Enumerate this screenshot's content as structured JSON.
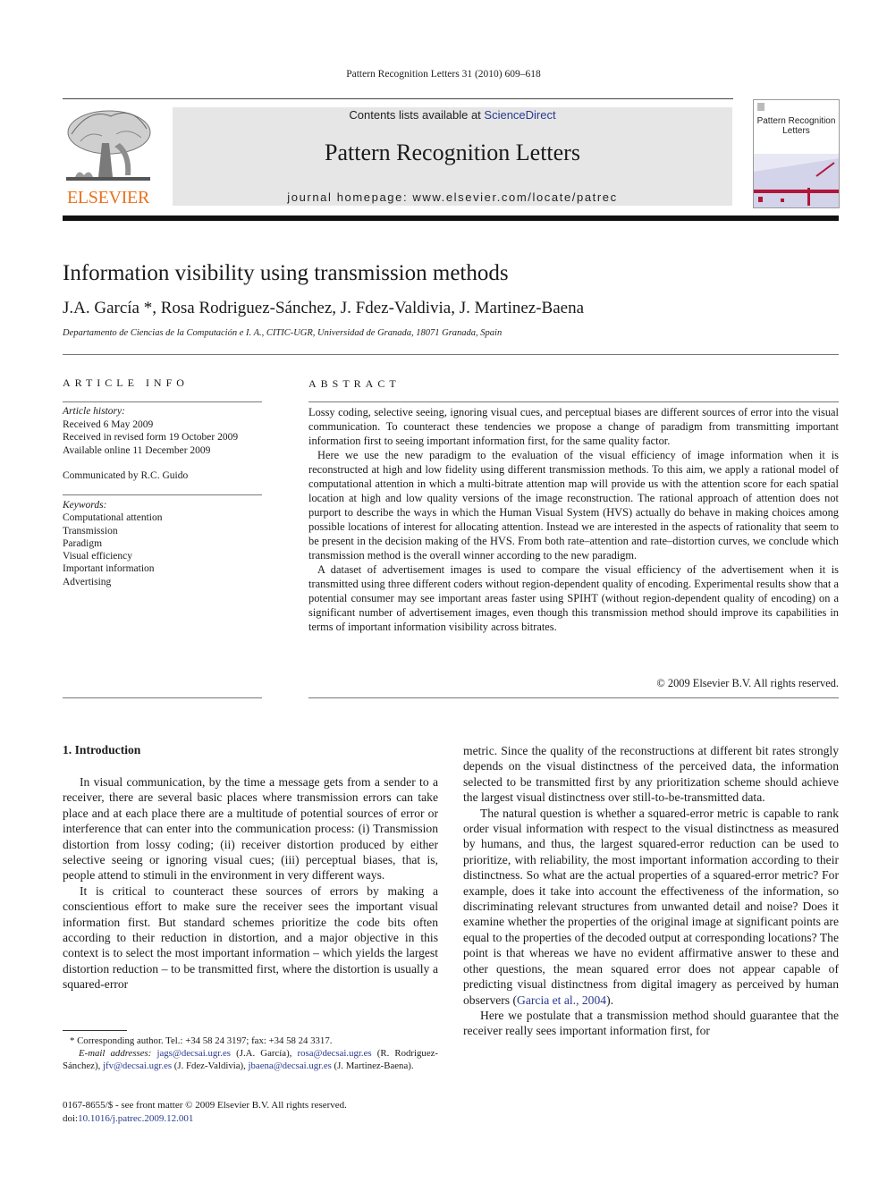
{
  "running_head": "Pattern Recognition Letters 31 (2010) 609–618",
  "masthead": {
    "publisher_logo_text": "ELSEVIER",
    "contents_prefix": "Contents lists available at ",
    "contents_link": "ScienceDirect",
    "journal_title": "Pattern Recognition Letters",
    "homepage": "journal homepage: www.elsevier.com/locate/patrec",
    "cover_title_line1": "Pattern Recognition",
    "cover_title_line2": "Letters",
    "colors": {
      "elsevier_orange": "#e9711c",
      "link_blue": "#2a3a8e",
      "banner_gray": "#e6e6e6"
    }
  },
  "article": {
    "title": "Information visibility using transmission methods",
    "authors": "J.A. García *, Rosa Rodriguez-Sánchez, J. Fdez-Valdivia, J. Martinez-Baena",
    "affiliation": "Departamento de Ciencias de la Computación e I. A., CITIC-UGR, Universidad de Granada, 18071 Granada, Spain"
  },
  "article_info": {
    "heading": "ARTICLE INFO",
    "history_label": "Article history:",
    "received": "Received 6 May 2009",
    "revised": "Received in revised form 19 October 2009",
    "online": "Available online 11 December 2009",
    "communicated": "Communicated by R.C. Guido",
    "keywords_label": "Keywords:",
    "keywords": [
      "Computational attention",
      "Transmission",
      "Paradigm",
      "Visual efficiency",
      "Important information",
      "Advertising"
    ]
  },
  "abstract": {
    "heading": "ABSTRACT",
    "paragraphs": [
      "Lossy coding, selective seeing, ignoring visual cues, and perceptual biases are different sources of error into the visual communication. To counteract these tendencies we propose a change of paradigm from transmitting important information first to seeing important information first, for the same quality factor.",
      "Here we use the new paradigm to the evaluation of the visual efficiency of image information when it is reconstructed at high and low fidelity using different transmission methods. To this aim, we apply a rational model of computational attention in which a multi-bitrate attention map will provide us with the attention score for each spatial location at high and low quality versions of the image reconstruction. The rational approach of attention does not purport to describe the ways in which the Human Visual System (HVS) actually do behave in making choices among possible locations of interest for allocating attention. Instead we are interested in the aspects of rationality that seem to be present in the decision making of the HVS. From both rate–attention and rate–distortion curves, we conclude which transmission method is the overall winner according to the new paradigm.",
      "A dataset of advertisement images is used to compare the visual efficiency of the advertisement when it is transmitted using three different coders without region-dependent quality of encoding. Experimental results show that a potential consumer may see important areas faster using SPIHT (without region-dependent quality of encoding) on a significant number of advertisement images, even though this transmission method should improve its capabilities in terms of important information visibility across bitrates."
    ],
    "copyright": "© 2009 Elsevier B.V. All rights reserved."
  },
  "body": {
    "section_heading": "1. Introduction",
    "col1_paragraphs": [
      "In visual communication, by the time a message gets from a sender to a receiver, there are several basic places where transmission errors can take place and at each place there are a multitude of potential sources of error or interference that can enter into the communication process: (i) Transmission distortion from lossy coding; (ii) receiver distortion produced by either selective seeing or ignoring visual cues; (iii) perceptual biases, that is, people attend to stimuli in the environment in very different ways.",
      "It is critical to counteract these sources of errors by making a conscientious effort to make sure the receiver sees the important visual information first. But standard schemes prioritize the code bits often according to their reduction in distortion, and a major objective in this context is to select the most important information – which yields the largest distortion reduction – to be transmitted first, where the distortion is usually a squared-error"
    ],
    "col2_continuation": "metric. Since the quality of the reconstructions at different bit rates strongly depends on the visual distinctness of the perceived data, the information selected to be transmitted first by any prioritization scheme should achieve the largest visual distinctness over still-to-be-transmitted data.",
    "col2_para2_text": "The natural question is whether a squared-error metric is capable to rank order visual information with respect to the visual distinctness as measured by humans, and thus, the largest squared-error reduction can be used to prioritize, with reliability, the most important information according to their distinctness. So what are the actual properties of a squared-error metric? For example, does it take into account the effectiveness of the information, so discriminating relevant structures from unwanted detail and noise? Does it examine whether the properties of the original image at significant points are equal to the properties of the decoded output at corresponding locations? The point is that whereas we have no evident affirmative answer to these and other questions, the mean squared error does not appear capable of predicting visual distinctness from digital imagery as perceived by human observers (",
    "col2_para2_cite": "Garcia et al., 2004",
    "col2_para2_end": ").",
    "col2_para3": "Here we postulate that a transmission method should guarantee that the receiver really sees important information first, for"
  },
  "footnotes": {
    "corresponding": "* Corresponding author. Tel.: +34 58 24 3197; fax: +34 58 24 3317.",
    "email_label": "E-mail addresses:",
    "emails": [
      {
        "address": "jags@decsai.ugr.es",
        "name": " (J.A. García), "
      },
      {
        "address": "rosa@decsai.ugr.es",
        "name": " (R. Rodriguez-Sánchez), "
      },
      {
        "address": "jfv@decsai.ugr.es",
        "name": " (J. Fdez-Valdivia), "
      },
      {
        "address": "jbaena@decsai.ugr.es",
        "name": " (J. Martinez-Baena)."
      }
    ],
    "issn": "0167-8655/$ - see front matter © 2009 Elsevier B.V. All rights reserved.",
    "doi_prefix": "doi:",
    "doi": "10.1016/j.patrec.2009.12.001"
  }
}
